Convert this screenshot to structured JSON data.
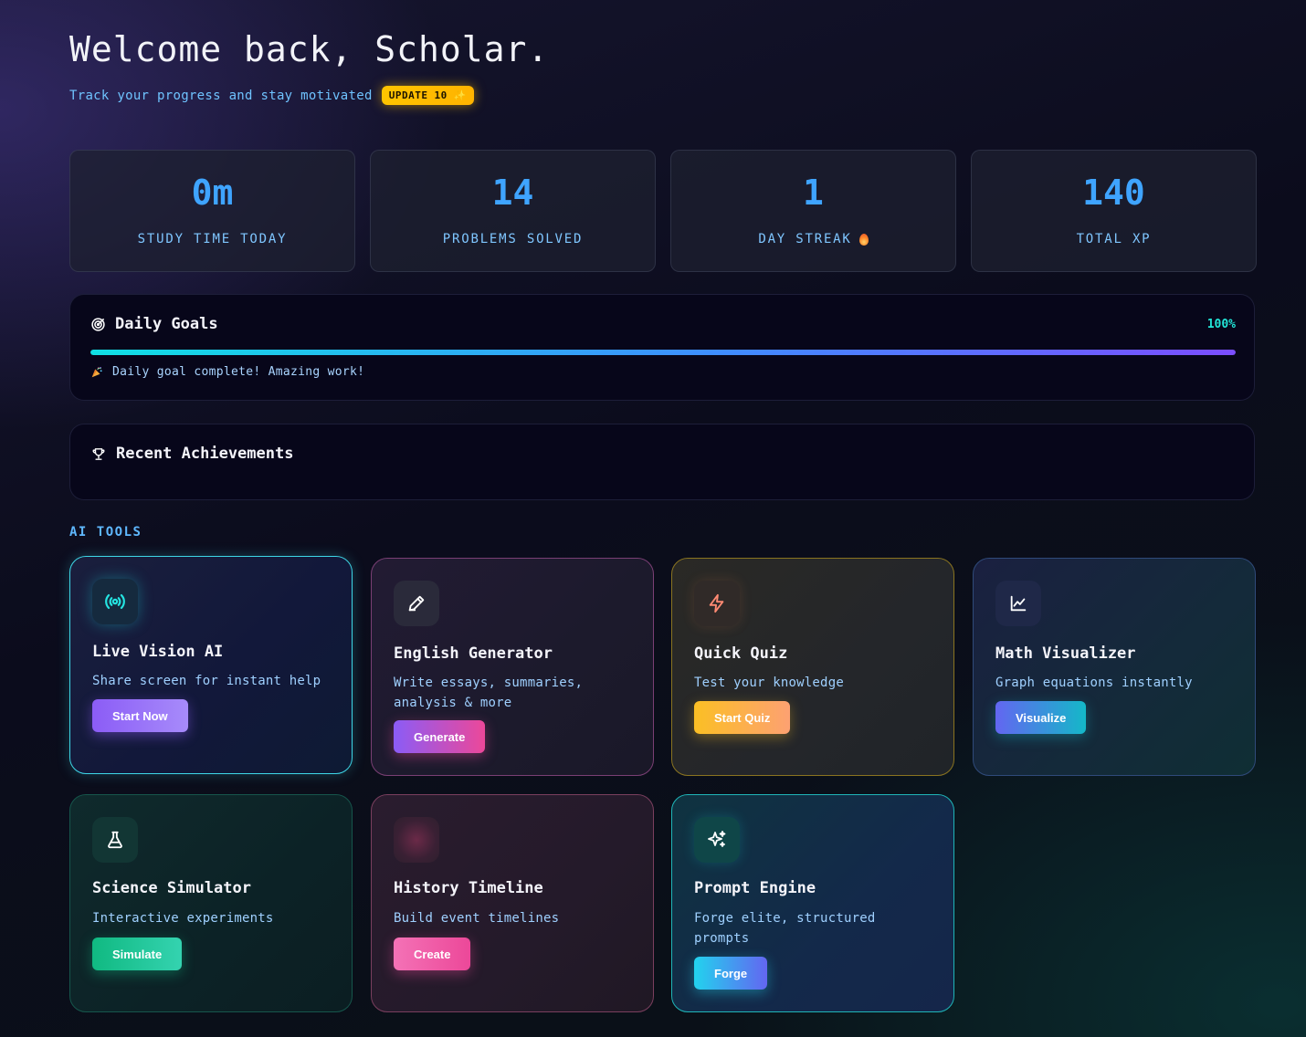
{
  "header": {
    "title": "Welcome back, Scholar.",
    "subtitle": "Track your progress and stay motivated",
    "badge": "UPDATE 10 ✨"
  },
  "stats": [
    {
      "value": "0m",
      "label": "STUDY TIME TODAY"
    },
    {
      "value": "14",
      "label": "PROBLEMS SOLVED"
    },
    {
      "value": "1",
      "label": "DAY STREAK"
    },
    {
      "value": "140",
      "label": "TOTAL XP"
    }
  ],
  "goals": {
    "title": "Daily Goals",
    "percent": "100%",
    "progress": 1.0,
    "message": "Daily goal complete! Amazing work!"
  },
  "achievements": {
    "title": "Recent Achievements"
  },
  "tools_section": {
    "label": "AI TOOLS"
  },
  "tools": [
    {
      "title": "Live Vision AI",
      "desc": "Share screen for instant help",
      "button": "Start Now",
      "icon": "broadcast-icon"
    },
    {
      "title": "English Generator",
      "desc": "Write essays, summaries, analysis & more",
      "button": "Generate",
      "icon": "pencil-icon"
    },
    {
      "title": "Quick Quiz",
      "desc": "Test your knowledge",
      "button": "Start Quiz",
      "icon": "lightning-icon"
    },
    {
      "title": "Math Visualizer",
      "desc": "Graph equations instantly",
      "button": "Visualize",
      "icon": "line-chart-icon"
    },
    {
      "title": "Science Simulator",
      "desc": "Interactive experiments",
      "button": "Simulate",
      "icon": "flask-icon"
    },
    {
      "title": "History Timeline",
      "desc": "Build event timelines",
      "button": "Create",
      "icon": "timeline-icon"
    },
    {
      "title": "Prompt Engine",
      "desc": "Forge elite, structured prompts",
      "button": "Forge",
      "icon": "sparkles-icon"
    }
  ]
}
